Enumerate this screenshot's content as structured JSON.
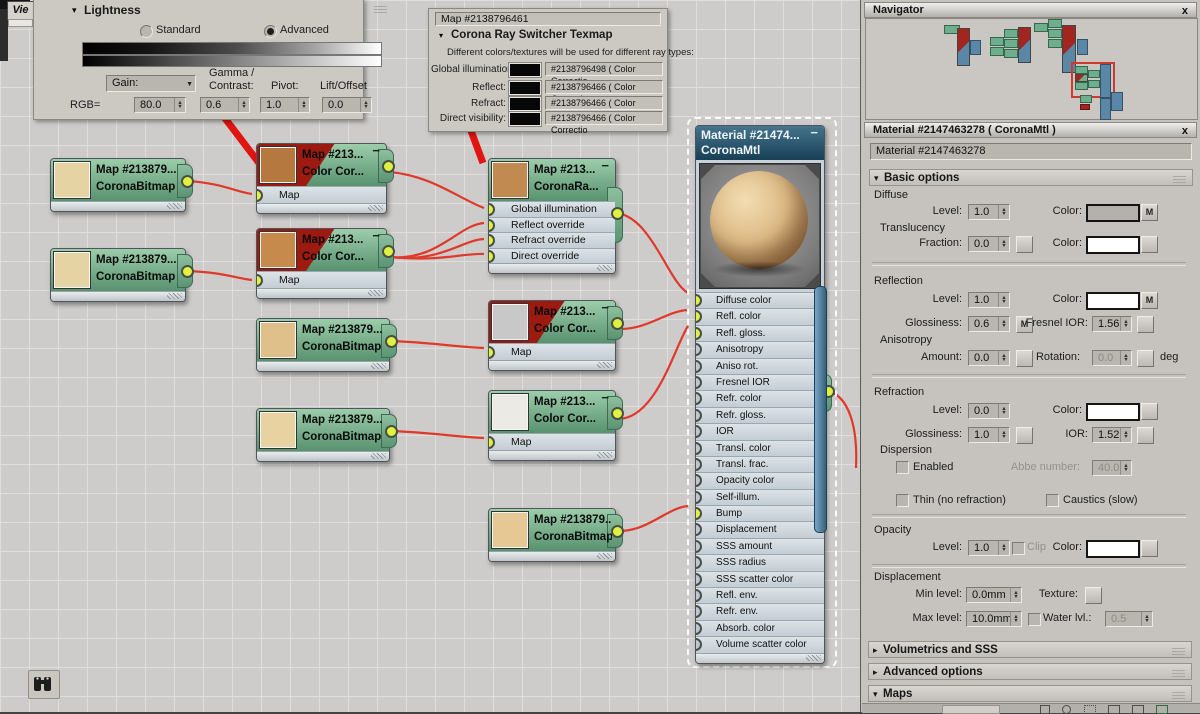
{
  "viewport_tab": "Vie",
  "find_icon": "binoculars",
  "lightness": {
    "title": "Lightness",
    "standard": "Standard",
    "advanced": "Advanced",
    "gain": "Gain:",
    "gamma1": "Gamma /",
    "gamma2": "Contrast:",
    "pivot": "Pivot:",
    "lift": "Lift/Offset",
    "rgb": "RGB=",
    "rgb_value": "80.0",
    "gamma_value": "0.6",
    "pivot_value": "1.0",
    "lift_value": "0.0"
  },
  "ray_panel": {
    "title": "Map #2138796461",
    "rollout": "Corona Ray Switcher Texmap",
    "desc": "Different colors/textures will be used for different ray types:",
    "rows": [
      {
        "label": "Global illumination:",
        "button": "#2138796498 ( Color Correctio"
      },
      {
        "label": "Reflect:",
        "button": "#2138796466 ( Color Correctio"
      },
      {
        "label": "Refract:",
        "button": "#2138796466 ( Color Correctio"
      },
      {
        "label": "Direct visibility:",
        "button": "#2138796466 ( Color Correctio"
      }
    ]
  },
  "nodes": {
    "bitmap": {
      "title": "Map #213879...",
      "subtitle": "CoronaBitmap"
    },
    "colorcor": {
      "title": "Map #213...",
      "subtitle": "Color Cor...",
      "slot": "Map",
      "minus": "−"
    },
    "rayswitcher": {
      "title": "Map #213...",
      "subtitle": "CoronaRa...",
      "minus": "−",
      "slots": [
        "Global illumination",
        "Reflect override",
        "Refract override",
        "Direct override"
      ]
    },
    "material": {
      "title": "Material #21474...",
      "subtitle": "CoronaMtl",
      "minus": "−",
      "slots": [
        "Diffuse color",
        "Refl. color",
        "Refl. gloss.",
        "Anisotropy",
        "Aniso rot.",
        "Fresnel IOR",
        "Refr. color",
        "Refr. gloss.",
        "IOR",
        "Transl. color",
        "Transl. frac.",
        "Opacity color",
        "Self-illum.",
        "Bump",
        "Displacement",
        "SSS amount",
        "SSS radius",
        "SSS scatter color",
        "Refl. env.",
        "Refr. env.",
        "Absorb. color",
        "Volume scatter color"
      ]
    }
  },
  "navigator": {
    "title": "Navigator",
    "close": "x"
  },
  "mat_editor": {
    "title": "Material #2147463278 ( CoronaMtl )",
    "close": "x",
    "name": "Material #2147463278",
    "basic_rollout": "Basic options",
    "arrow_open": "▾",
    "arrow_closed": "▸",
    "diffuse": {
      "group": "Diffuse",
      "level_label": "Level:",
      "level": "1.0",
      "color_label": "Color:",
      "m": "M"
    },
    "translucency": {
      "group": "Translucency",
      "fraction_label": "Fraction:",
      "fraction": "0.0",
      "color_label": "Color:"
    },
    "reflection": {
      "group": "Reflection",
      "level_label": "Level:",
      "level": "1.0",
      "color_label": "Color:",
      "m": "M",
      "gloss_label": "Glossiness:",
      "gloss": "0.6",
      "gloss_m": "M",
      "fresnel_label": "Fresnel IOR:",
      "fresnel": "1.56"
    },
    "anisotropy": {
      "group": "Anisotropy",
      "amount_label": "Amount:",
      "amount": "0.0",
      "rot_label": "Rotation:",
      "rot": "0.0",
      "deg": "deg"
    },
    "refraction": {
      "group": "Refraction",
      "level_label": "Level:",
      "level": "0.0",
      "color_label": "Color:",
      "gloss_label": "Glossiness:",
      "gloss": "1.0",
      "ior_label": "IOR:",
      "ior": "1.52"
    },
    "dispersion": {
      "group": "Dispersion",
      "enabled": "Enabled",
      "abbe_label": "Abbe number:",
      "abbe": "40.0"
    },
    "thin": "Thin (no refraction)",
    "caustics": "Caustics (slow)",
    "opacity": {
      "group": "Opacity",
      "level_label": "Level:",
      "level": "1.0",
      "clip": "Clip",
      "color_label": "Color:"
    },
    "displacement": {
      "group": "Displacement",
      "min_label": "Min level:",
      "min": "0.0mm",
      "tex_label": "Texture:",
      "max_label": "Max level:",
      "max": "10.0mm",
      "water_label": "Water lvl.:",
      "water": "0.5"
    },
    "volumetrics_rollout": "Volumetrics and SSS",
    "advanced_rollout": "Advanced options",
    "maps_rollout": "Maps"
  }
}
